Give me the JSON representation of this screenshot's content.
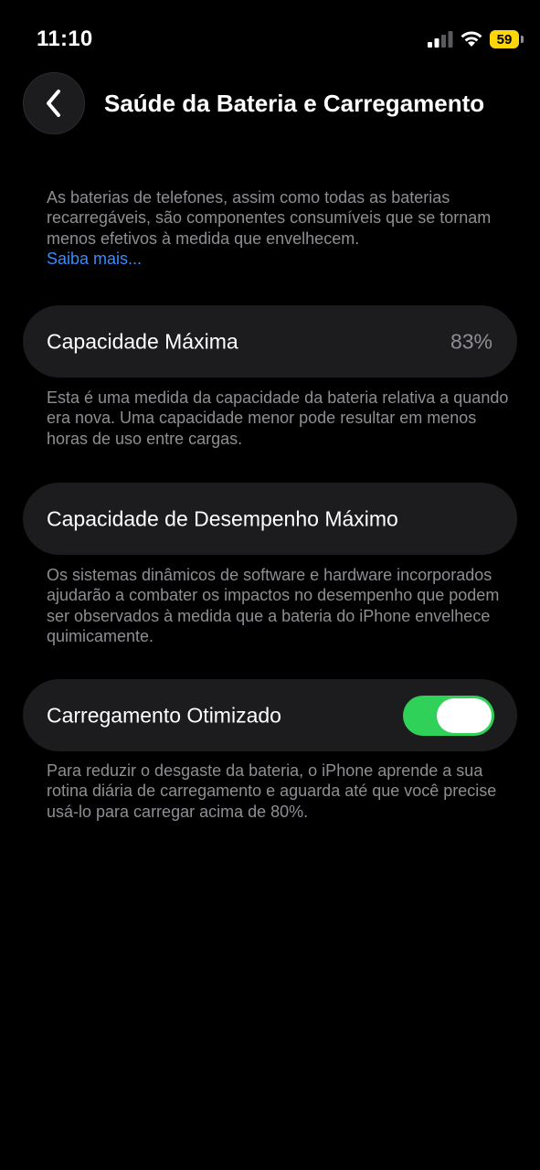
{
  "status_bar": {
    "time": "11:10",
    "battery_level": "59",
    "signal_icon": "cellular-signal-icon",
    "wifi_icon": "wifi-icon",
    "battery_color": "#ffd60a"
  },
  "nav": {
    "back_icon": "chevron-left-icon",
    "title": "Saúde da Bateria e Carregamento"
  },
  "intro": {
    "text": "As baterias de telefones, assim como todas as baterias recarregáveis, são componentes consumíveis que se tornam menos efetivos à medida que envelhecem.",
    "link": "Saiba mais..."
  },
  "max_capacity": {
    "label": "Capacidade Máxima",
    "value": "83%",
    "footnote": "Esta é uma medida da capacidade da bateria relativa a quando era nova. Uma capacidade menor pode resultar em menos horas de uso entre cargas."
  },
  "peak_performance": {
    "label": "Capacidade de Desempenho Máximo",
    "footnote": "Os sistemas dinâmicos de software e hardware incorporados ajudarão a combater os impactos no desempenho que podem ser observados à medida que a bateria do iPhone envelhece quimicamente."
  },
  "optimized_charging": {
    "label": "Carregamento Otimizado",
    "enabled": true,
    "toggle_color": "#30d158",
    "footnote": "Para reduzir o desgaste da bateria, o iPhone aprende a sua rotina diária de carregamento e aguarda até que você precise usá-lo para carregar acima de 80%."
  },
  "colors": {
    "background": "#000000",
    "cell_background": "#1c1c1e",
    "secondary_text": "#8e8e93",
    "link": "#3a8bff"
  }
}
